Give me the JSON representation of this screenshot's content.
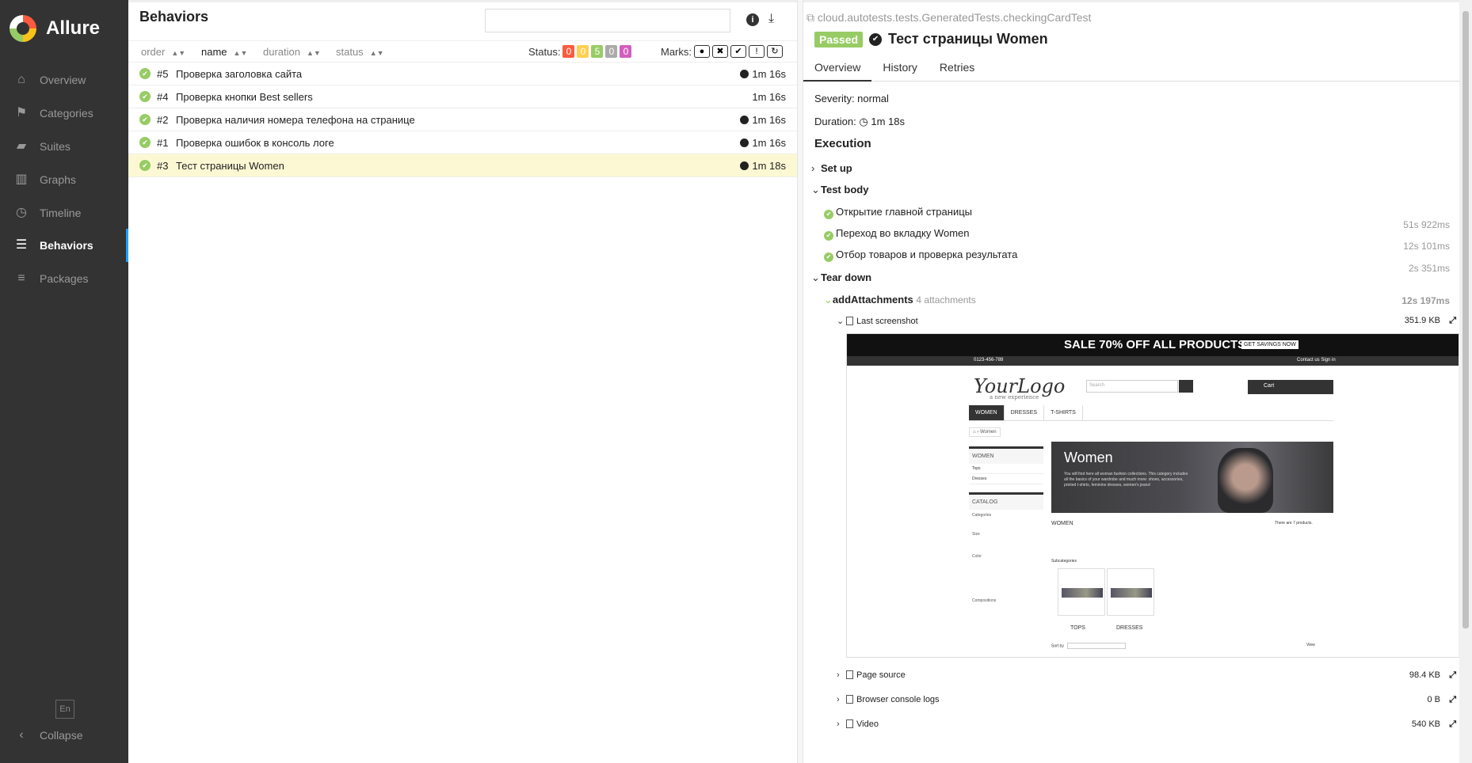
{
  "app": {
    "name": "Allure"
  },
  "sidebar": {
    "items": [
      {
        "label": "Overview",
        "icon": "home-icon"
      },
      {
        "label": "Categories",
        "icon": "flag-icon"
      },
      {
        "label": "Suites",
        "icon": "briefcase-icon"
      },
      {
        "label": "Graphs",
        "icon": "bar-chart-icon"
      },
      {
        "label": "Timeline",
        "icon": "clock-icon"
      },
      {
        "label": "Behaviors",
        "icon": "list-icon",
        "active": true
      },
      {
        "label": "Packages",
        "icon": "align-left-icon"
      }
    ],
    "lang": "En",
    "collapse": "Collapse"
  },
  "behaviors": {
    "title": "Behaviors",
    "search_placeholder": "",
    "sort": {
      "order": "order",
      "name": "name",
      "duration": "duration",
      "status": "status"
    },
    "status_label": "Status:",
    "status_counts": [
      {
        "value": "0",
        "color": "#fd5a3e"
      },
      {
        "value": "0",
        "color": "#ffd050"
      },
      {
        "value": "5",
        "color": "#97cc64"
      },
      {
        "value": "0",
        "color": "#aaaaaa"
      },
      {
        "value": "0",
        "color": "#d35ebe"
      }
    ],
    "marks_label": "Marks:",
    "rows": [
      {
        "num": "#5",
        "name": "Проверка заголовка сайта",
        "duration": "1m 16s",
        "clock": true
      },
      {
        "num": "#4",
        "name": "Проверка кнопки Best sellers",
        "duration": "1m 16s",
        "clock": false
      },
      {
        "num": "#2",
        "name": "Проверка наличия номера телефона на странице",
        "duration": "1m 16s",
        "clock": true
      },
      {
        "num": "#1",
        "name": "Проверка ошибок в консоль логе",
        "duration": "1m 16s",
        "clock": true
      },
      {
        "num": "#3",
        "name": "Тест страницы Women",
        "duration": "1m 18s",
        "clock": true,
        "selected": true
      }
    ]
  },
  "detail": {
    "path": "cloud.autotests.tests.GeneratedTests.checkingCardTest",
    "badge": "Passed",
    "title": "Тест страницы Women",
    "tabs": [
      "Overview",
      "History",
      "Retries"
    ],
    "severity": "Severity: normal",
    "duration_label": "Duration:",
    "duration_value": "1m 18s",
    "execution": "Execution",
    "setup": "Set up",
    "test_body": "Test body",
    "steps": [
      {
        "name": "Открытие главной страницы",
        "dur": ""
      },
      {
        "name": "Переход во вкладку Women",
        "dur": "51s 922ms"
      },
      {
        "name": "Отбор товаров и проверка результата",
        "dur": "12s 101ms"
      }
    ],
    "extra_dur": "2s 351ms",
    "teardown": "Tear down",
    "add_att": "addAttachments",
    "att_count": "4 attachments",
    "add_att_dur": "12s 197ms",
    "attachments": [
      {
        "name": "Last screenshot",
        "size": "351.9 KB"
      },
      {
        "name": "Page source",
        "size": "98.4 KB"
      },
      {
        "name": "Browser console logs",
        "size": "0 B"
      },
      {
        "name": "Video",
        "size": "540 KB"
      }
    ]
  },
  "screenshot": {
    "banner": "SALE 70% OFF ALL PRODUCTS",
    "cta": "GET SAVINGS NOW",
    "phone": "0123-456-789",
    "contact": "Contact us    Sign in",
    "logo": "YourLogo",
    "logo_sub": "a new experience",
    "search": "Search",
    "cart": "Cart",
    "menu": [
      "WOMEN",
      "DRESSES",
      "T-SHIRTS"
    ],
    "crumb": "Women",
    "left_head": "WOMEN",
    "left_items": [
      "Tops",
      "Dresses"
    ],
    "catalog": "CATALOG",
    "cat_title": "Women",
    "cat_desc": "You will find here all woman fashion collections. This category includes all the basics of your wardrobe and much more: shoes, accessories, printed t-shirts, feminine dresses, women's jeans!",
    "women": "WOMEN",
    "prodcount": "There are 7 products.",
    "subcategories": "Subcategories",
    "tops": "TOPS",
    "dresses": "DRESSES",
    "sortby": "Sort by",
    "view": "View",
    "filters": [
      "Categories",
      "Size",
      "Color",
      "Compositions"
    ]
  },
  "colors": {
    "sidebar_bg": "#333333",
    "accent": "#1ca2ff",
    "passed": "#97cc64",
    "selected_row": "#fdf8d4"
  }
}
